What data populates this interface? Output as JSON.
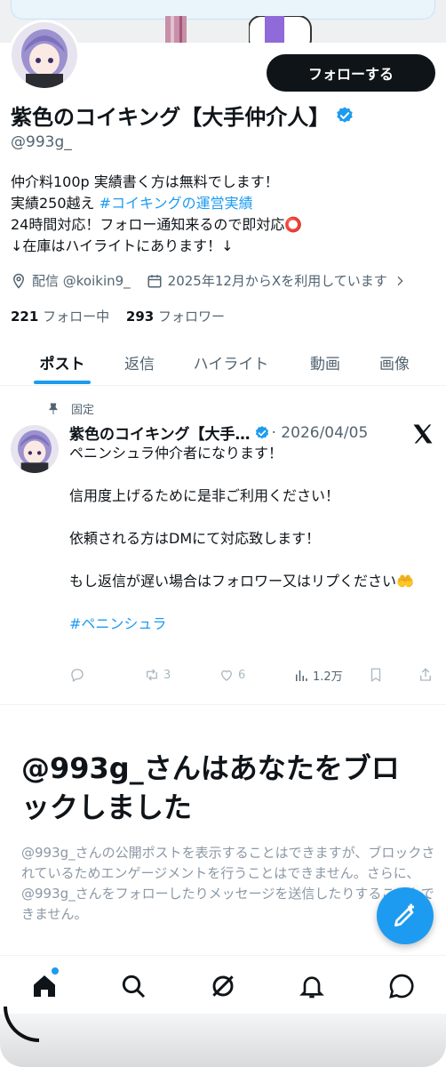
{
  "profile": {
    "display_name": "紫色のコイキング【大手仲介人】",
    "handle": "@993g_",
    "follow_button": "フォローする",
    "bio_line1": "仲介料100p 実績書く方は無料でします！",
    "bio_line2_text": "実績250越え ",
    "bio_line2_tag": "#コイキングの運営実績",
    "bio_line3": "24時間対応！フォロー通知来るので即対応⭕️",
    "bio_line4": "↓在庫はハイライトにあります！↓",
    "location": "配信 @koikin9_",
    "joined": "2025年12月からXを利用しています",
    "following_count": "221",
    "following_label": "フォロー中",
    "followers_count": "293",
    "followers_label": "フォロワー"
  },
  "tabs": [
    "ポスト",
    "返信",
    "ハイライト",
    "動画",
    "画像"
  ],
  "pinned_tweet": {
    "pinned_label": "固定",
    "author_name": "紫色のコイキング【大手…",
    "date": "· 2026/04/05",
    "line1": "ペニンシュラ仲介者になります！",
    "line2": "信用度上げるために是非ご利用ください！",
    "line3": "依頼される方はDMにて対応致します！",
    "line4": "もし返信が遅い場合はフォロワー又はリプください🤲",
    "hashtag": "#ペニンシュラ",
    "retweets": "3",
    "likes": "6",
    "views": "1.2万"
  },
  "blocked": {
    "title": "@993g_さんはあなたをブロックしました",
    "text": "@993g_さんの公開ポストを表示することはできますが、ブロックされているためエンゲージメントを行うことはできません。さらに、@993g_さんをフォローしたりメッセージを送信したりすることもできません。"
  },
  "colors": {
    "accent": "#1d9bf0",
    "text": "#0f1419",
    "muted": "#536471"
  },
  "icons": {
    "nav": [
      "home-icon",
      "search-icon",
      "grok-icon",
      "notifications-icon",
      "messages-icon"
    ],
    "fab": "compose-icon"
  }
}
